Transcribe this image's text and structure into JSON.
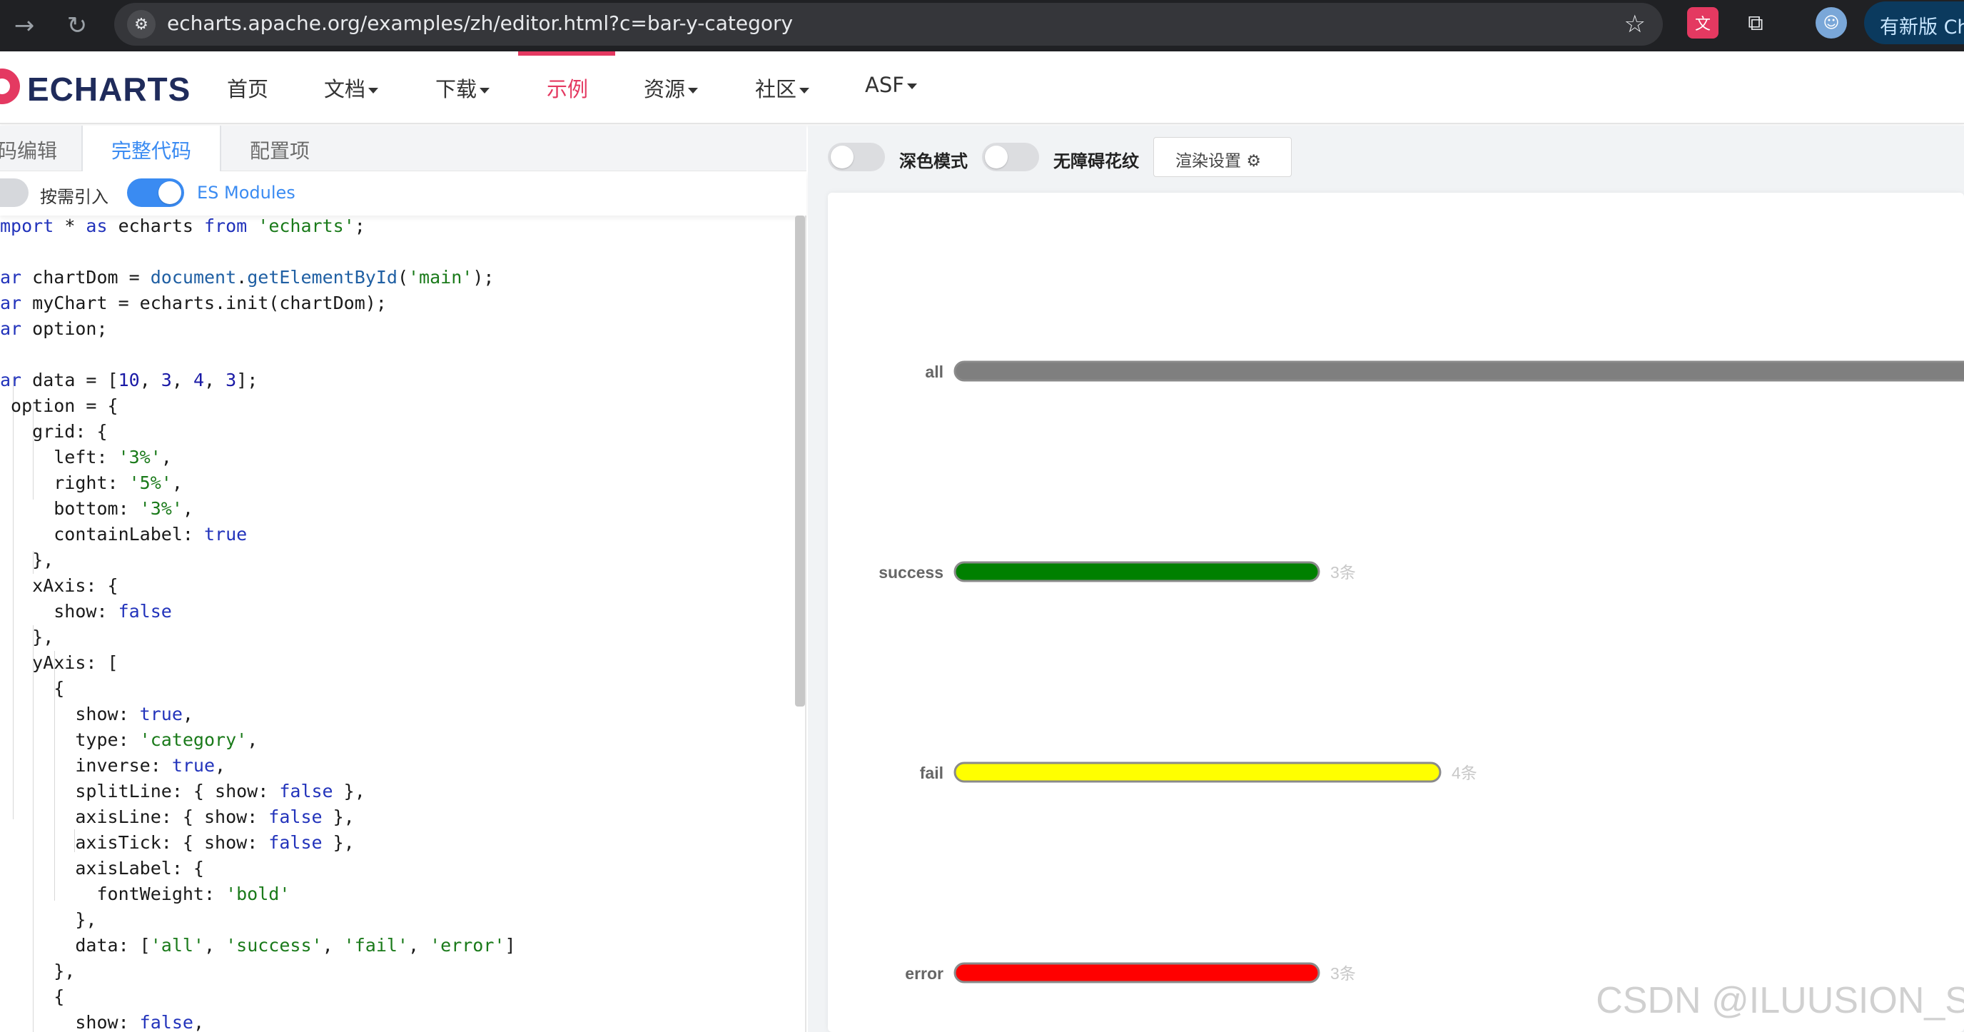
{
  "browser": {
    "url": "echarts.apache.org/examples/zh/editor.html?c=bar-y-category",
    "update_label": "有新版 Ch"
  },
  "header": {
    "logo": "ECHARTS",
    "nav": [
      {
        "label": "首页"
      },
      {
        "label": "文档"
      },
      {
        "label": "下载"
      },
      {
        "label": "示例"
      },
      {
        "label": "资源"
      },
      {
        "label": "社区"
      },
      {
        "label": "ASF"
      }
    ],
    "active_color": "#e43961"
  },
  "editor": {
    "tabs": [
      "码编辑",
      "完整代码",
      "配置项"
    ],
    "options": {
      "on_demand": "按需引入",
      "es_modules": "ES Modules"
    }
  },
  "preview": {
    "toolbar": {
      "dark_mode": "深色模式",
      "a11y": "无障碍花纹",
      "render_settings": "渲染设置"
    },
    "watermark": "CSDN @ILUUSION_S"
  },
  "chart_data": {
    "type": "bar",
    "orientation": "horizontal",
    "categories": [
      "all",
      "success",
      "fail",
      "error"
    ],
    "values": [
      10,
      3,
      4,
      3
    ],
    "value_labels": [
      "",
      "3条",
      "4条",
      "3条"
    ],
    "colors": [
      "#7f7f7f",
      "#008000",
      "#ffff00",
      "#ff0000"
    ],
    "xlim": [
      0,
      10
    ],
    "grid": false
  }
}
